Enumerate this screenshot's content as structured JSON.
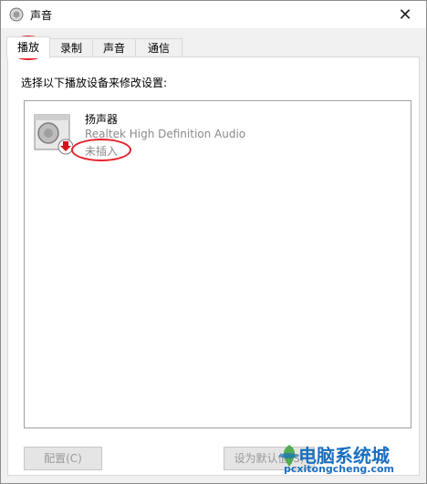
{
  "window": {
    "title": "声音"
  },
  "tabs": [
    {
      "label": "播放",
      "active": true
    },
    {
      "label": "录制",
      "active": false
    },
    {
      "label": "声音",
      "active": false
    },
    {
      "label": "通信",
      "active": false
    }
  ],
  "panel": {
    "instruction": "选择以下播放设备来修改设置:"
  },
  "devices": [
    {
      "name": "扬声器",
      "driver": "Realtek High Definition Audio",
      "status": "未插入",
      "icon": "speaker-icon"
    }
  ],
  "buttons": {
    "configure_label": "配置(C)",
    "set_default_label": "设为默认值(S)"
  },
  "watermark": {
    "line1": "电脑系统城",
    "line2": "pcxitongcheng.com"
  },
  "colors": {
    "annotation": "#e5202a",
    "watermark": "#1a6fc0",
    "disabled_text": "#8a8a8a"
  }
}
